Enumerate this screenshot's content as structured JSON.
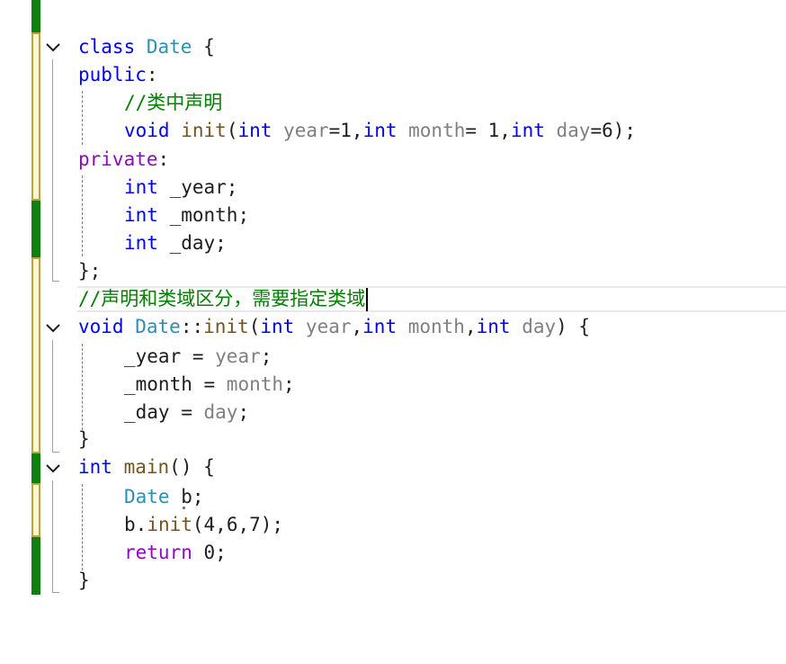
{
  "colors": {
    "keyword": "#0000ff",
    "control_keyword": "#8f08c4",
    "type": "#2b91af",
    "function": "#74531f",
    "parameter": "#808080",
    "comment": "#008000",
    "change_saved": "#108010",
    "change_unsaved": "#fdf6d6"
  },
  "icons": {
    "fold": "chevron-down-icon"
  },
  "code": {
    "l1": {
      "kw": "class",
      "sp": " ",
      "ty": "Date",
      "rest": " {"
    },
    "l2": {
      "kw": "public",
      "rest": ":"
    },
    "l3": {
      "cm": "//类中声明"
    },
    "l4": {
      "kw_void": "void",
      "sp1": " ",
      "fn": "init",
      "p1": "(",
      "kw_int1": "int",
      "pm1": " year",
      "v1": "=1,",
      "kw_int2": "int",
      "pm2": " month",
      "v2": "= 1,",
      "kw_int3": "int",
      "pm3": " day",
      "v3": "=6);"
    },
    "l5": {
      "kw": "private",
      "rest": ":"
    },
    "l6": {
      "kw": "int",
      "rest": " _year;"
    },
    "l7": {
      "kw": "int",
      "rest": " _month;"
    },
    "l8": {
      "kw": "int",
      "rest": " _day;"
    },
    "l9": {
      "rest": "};"
    },
    "l10": {
      "cm": "//声明和类域区分，需要指定类域"
    },
    "l11": {
      "kw_void": "void",
      "sp1": " ",
      "ty": "Date",
      "sep": "::",
      "fn": "init",
      "p1": "(",
      "kw_int1": "int",
      "pm1": " year",
      "c1": ",",
      "kw_int2": "int",
      "pm2": " month",
      "c2": ",",
      "kw_int3": "int",
      "pm3": " day",
      "p2": ")",
      "rest": " {"
    },
    "l12": {
      "member": "_year",
      "op": " = ",
      "pm": "year",
      "end": ";"
    },
    "l13": {
      "member": "_month",
      "op": " = ",
      "pm": "month",
      "end": ";"
    },
    "l14": {
      "member": "_day",
      "op": " = ",
      "pm": "day",
      "end": ";"
    },
    "l15": {
      "rest": "}"
    },
    "l16": {
      "kw": "int",
      "sp": " ",
      "fn": "main",
      "rest": "() {"
    },
    "l17": {
      "ty": "Date",
      "rest": " b;"
    },
    "l18": {
      "obj": "b",
      "dot": ".",
      "fn": "init",
      "rest": "(4,6,7);"
    },
    "l19": {
      "kw": "return",
      "rest": " 0;"
    },
    "l20": {
      "rest": "}"
    }
  }
}
